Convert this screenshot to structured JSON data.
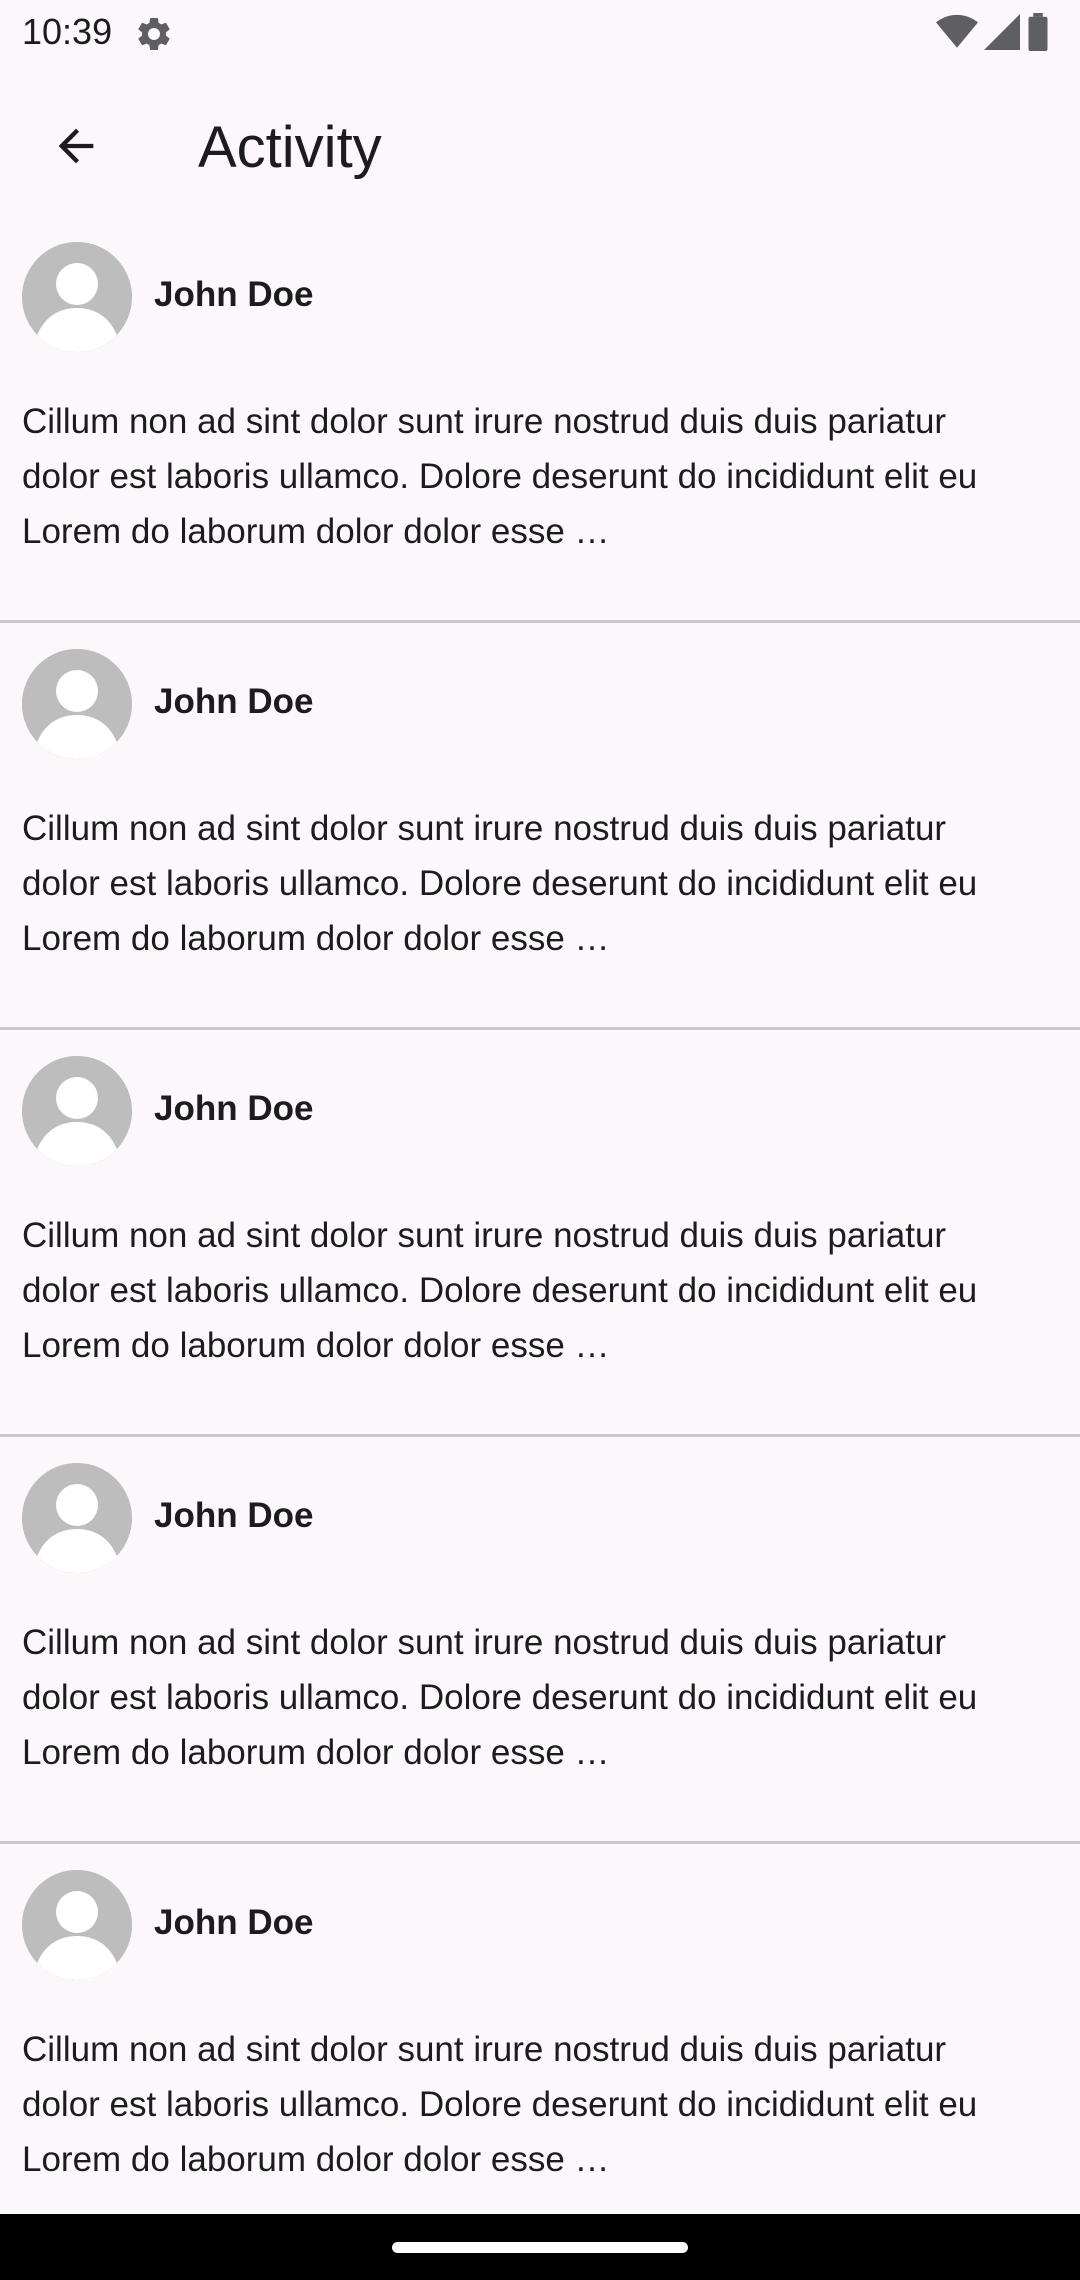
{
  "status_bar": {
    "time": "10:39",
    "icons": [
      "settings-gear-icon",
      "wifi-icon",
      "cell-signal-icon",
      "battery-icon"
    ]
  },
  "app_bar": {
    "back_icon": "arrow-back-icon",
    "title": "Activity"
  },
  "activities": [
    {
      "name": "John Doe",
      "text": "Cillum non ad sint dolor sunt irure nostrud duis duis pariatur dolor est laboris ullamco. Dolore deserunt do incididunt elit eu Lorem do laborum dolor dolor esse …"
    },
    {
      "name": "John Doe",
      "text": "Cillum non ad sint dolor sunt irure nostrud duis duis pariatur dolor est laboris ullamco. Dolore deserunt do incididunt elit eu Lorem do laborum dolor dolor esse …"
    },
    {
      "name": "John Doe",
      "text": "Cillum non ad sint dolor sunt irure nostrud duis duis pariatur dolor est laboris ullamco. Dolore deserunt do incididunt elit eu Lorem do laborum dolor dolor esse …"
    },
    {
      "name": "John Doe",
      "text": "Cillum non ad sint dolor sunt irure nostrud duis duis pariatur dolor est laboris ullamco. Dolore deserunt do incididunt elit eu Lorem do laborum dolor dolor esse …"
    },
    {
      "name": "John Doe",
      "text": "Cillum non ad sint dolor sunt irure nostrud duis duis pariatur dolor est laboris ullamco. Dolore deserunt do incididunt elit eu Lorem do laborum dolor dolor esse …"
    }
  ],
  "colors": {
    "background": "#fcf7fb",
    "divider": "#cbc7cc",
    "text": "#1c1b1f",
    "avatar": "#bdbdbd"
  }
}
